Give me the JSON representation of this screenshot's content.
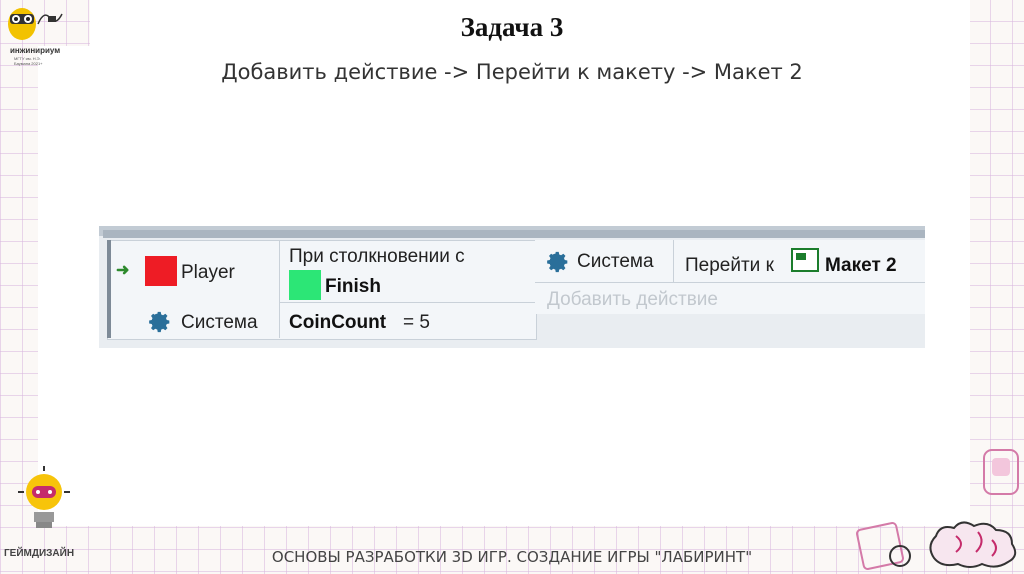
{
  "slide": {
    "title": "Задача 3",
    "subtitle": "Добавить действие -> Перейти к макету -> Макет 2",
    "footer": "ОСНОВЫ РАЗРАБОТКИ 3D ИГР. СОЗДАНИЕ ИГРЫ \"ЛАБИРИНТ\"",
    "logo_text": "инжинириум",
    "logo_subtext": "МГТУ им. Н.Э. Баумана 2021+",
    "brand_label": "ГЕЙМДИЗАЙН"
  },
  "event_sheet": {
    "condition_object_1": "Player",
    "condition_1_line1": "При столкновении с",
    "condition_1_object": "Finish",
    "condition_object_2": "Система",
    "condition_2_variable": "CoinCount",
    "condition_2_rest": "= 5",
    "action_object": "Система",
    "action_text": "Перейти к",
    "action_target": "Макет 2",
    "add_action_label": "Добавить действие"
  },
  "colors": {
    "player": "#ee1c25",
    "finish": "#2ce676",
    "gear": "#2a6f9a",
    "arrow": "#2d8a2d"
  },
  "icons": [
    "gear-icon",
    "layout-icon",
    "arrow-right-icon"
  ]
}
